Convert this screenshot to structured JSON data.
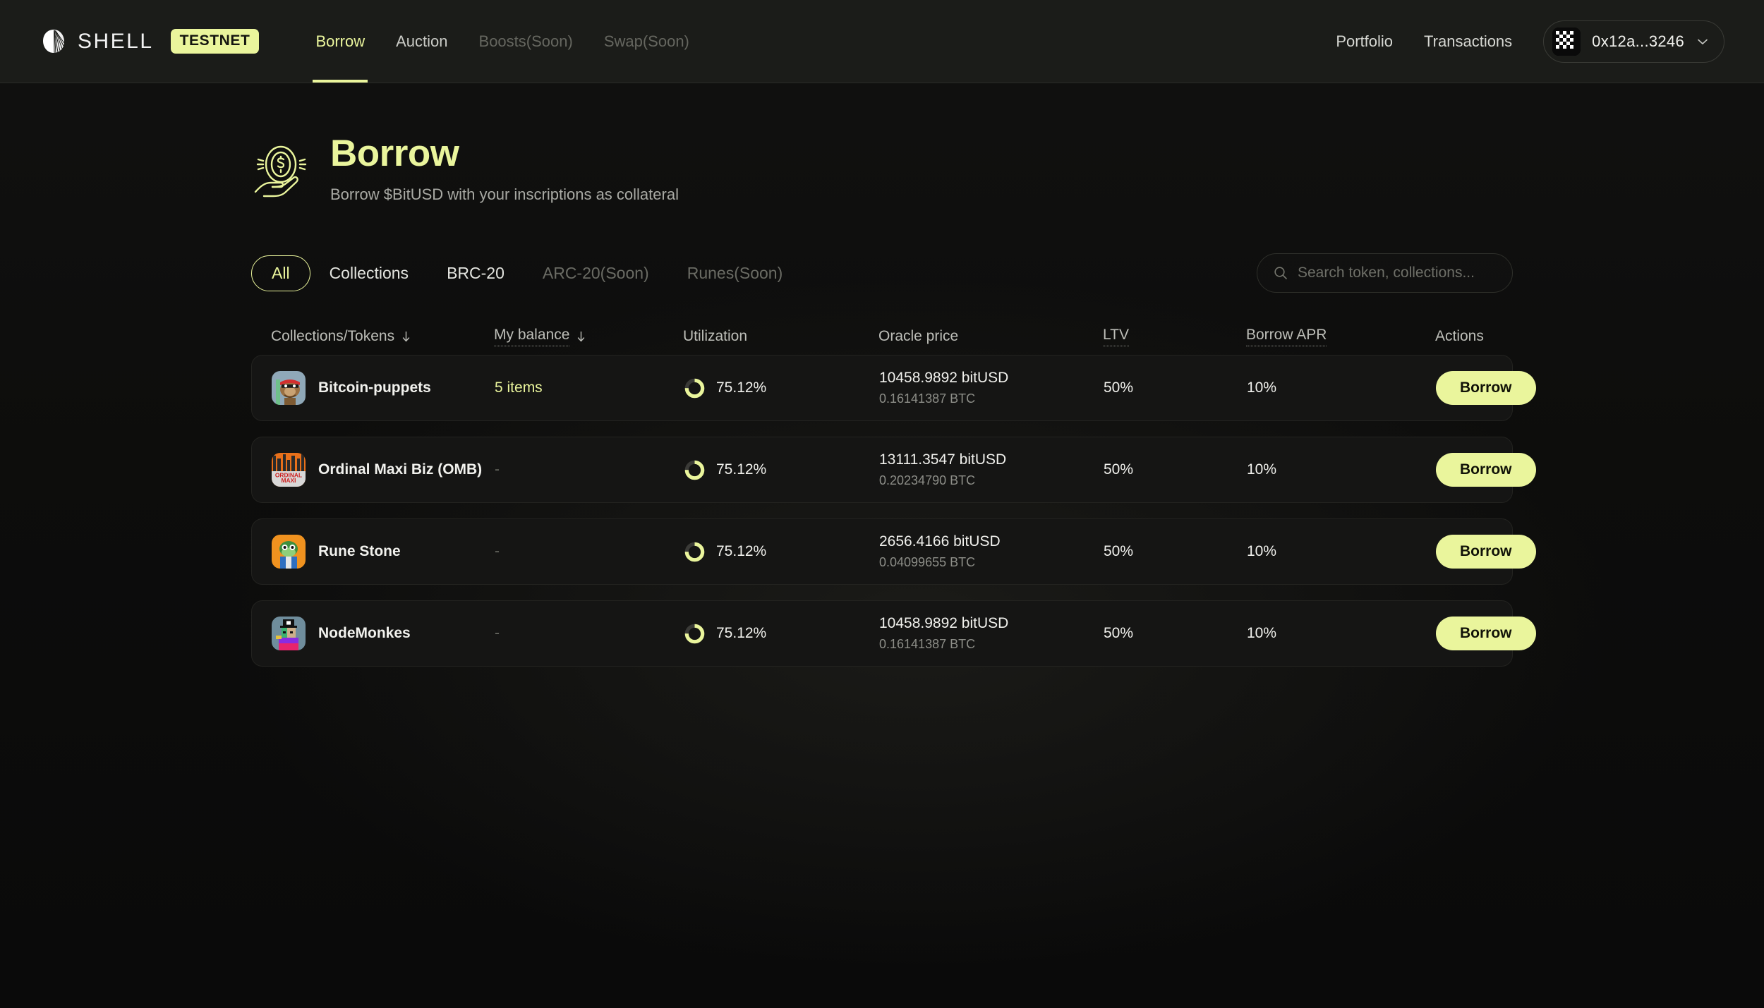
{
  "header": {
    "brand_name": "SHELL",
    "badge": "TESTNET",
    "logo_icon": "shell-fan-logo",
    "nav": [
      {
        "label": "Borrow",
        "state": "active"
      },
      {
        "label": "Auction",
        "state": "default"
      },
      {
        "label": "Boosts(Soon)",
        "state": "disabled"
      },
      {
        "label": "Swap(Soon)",
        "state": "disabled"
      }
    ],
    "links": [
      {
        "label": "Portfolio"
      },
      {
        "label": "Transactions"
      }
    ],
    "wallet": {
      "address": "0x12a...3246",
      "avatar_icon": "wallet-identicon",
      "chevron_icon": "chevron-down-icon"
    }
  },
  "hero": {
    "icon": "coin-in-hand-icon",
    "title": "Borrow",
    "subtitle": "Borrow $BitUSD with your inscriptions as collateral"
  },
  "filters": {
    "tabs": [
      {
        "label": "All",
        "state": "active"
      },
      {
        "label": "Collections",
        "state": "default"
      },
      {
        "label": "BRC-20",
        "state": "default"
      },
      {
        "label": "ARC-20(Soon)",
        "state": "disabled"
      },
      {
        "label": "Runes(Soon)",
        "state": "disabled"
      }
    ],
    "search": {
      "placeholder": "Search token, collections...",
      "value": "",
      "icon": "search-icon"
    }
  },
  "table": {
    "columns": [
      {
        "label": "Collections/Tokens",
        "sortable": true,
        "dotted": false
      },
      {
        "label": "My balance",
        "sortable": true,
        "dotted": true
      },
      {
        "label": "Utilization",
        "sortable": false,
        "dotted": false
      },
      {
        "label": "Oracle price",
        "sortable": false,
        "dotted": false
      },
      {
        "label": "LTV",
        "sortable": false,
        "dotted": true
      },
      {
        "label": "Borrow APR",
        "sortable": false,
        "dotted": true
      },
      {
        "label": "Actions",
        "sortable": false,
        "dotted": false
      }
    ],
    "rows": [
      {
        "name": "Bitcoin-puppets",
        "avatar": "bitcoin-puppets-avatar",
        "balance": "5 items",
        "has_balance": true,
        "utilization": "75.12%",
        "utilization_pct": 75.12,
        "oracle_price": "10458.9892 bitUSD",
        "oracle_price_btc": "0.16141387 BTC",
        "ltv": "50%",
        "borrow_apr": "10%",
        "action_label": "Borrow"
      },
      {
        "name": "Ordinal Maxi Biz (OMB)",
        "avatar": "ordinal-maxi-biz-avatar",
        "balance": "-",
        "has_balance": false,
        "utilization": "75.12%",
        "utilization_pct": 75.12,
        "oracle_price": "13111.3547 bitUSD",
        "oracle_price_btc": "0.20234790 BTC",
        "ltv": "50%",
        "borrow_apr": "10%",
        "action_label": "Borrow"
      },
      {
        "name": "Rune Stone",
        "avatar": "rune-stone-avatar",
        "balance": "-",
        "has_balance": false,
        "utilization": "75.12%",
        "utilization_pct": 75.12,
        "oracle_price": "2656.4166 bitUSD",
        "oracle_price_btc": "0.04099655 BTC",
        "ltv": "50%",
        "borrow_apr": "10%",
        "action_label": "Borrow"
      },
      {
        "name": "NodeMonkes",
        "avatar": "nodemonkes-avatar",
        "balance": "-",
        "has_balance": false,
        "utilization": "75.12%",
        "utilization_pct": 75.12,
        "oracle_price": "10458.9892 bitUSD",
        "oracle_price_btc": "0.16141387 BTC",
        "ltv": "50%",
        "borrow_apr": "10%",
        "action_label": "Borrow"
      }
    ]
  },
  "colors": {
    "accent": "#eaf59c",
    "page_bg": "#0d0d0c",
    "header_bg": "#1b1c19",
    "row_bg": "#151514",
    "text_primary": "#f1f1ed",
    "text_muted": "#8d8e88",
    "donut_track": "#3a3a37"
  }
}
